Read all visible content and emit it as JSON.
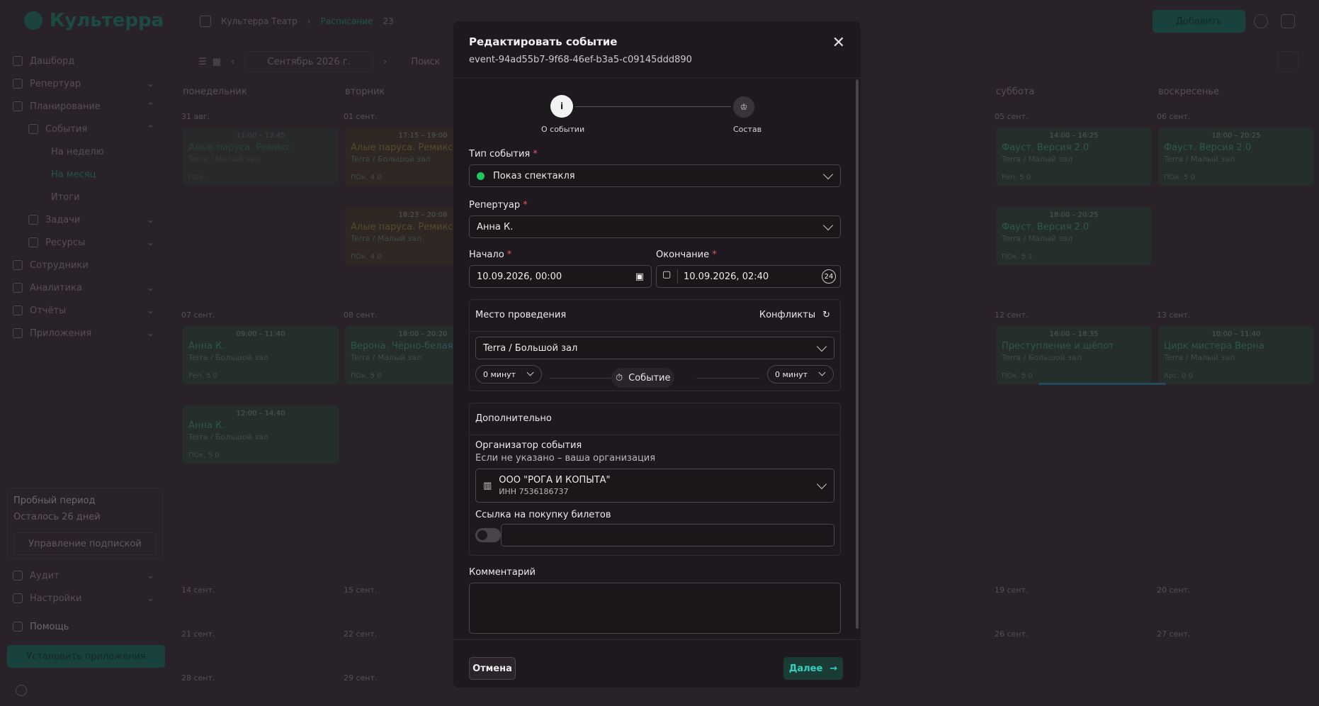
{
  "sidebar": {
    "logo": "Культерра",
    "items": [
      {
        "label": "Дашборд"
      },
      {
        "label": "Репертуар"
      },
      {
        "label": "Планирование"
      },
      {
        "label": "События"
      },
      {
        "label": "На неделю"
      },
      {
        "label": "На месяц"
      },
      {
        "label": "Итоги"
      },
      {
        "label": "Задачи"
      },
      {
        "label": "Ресурсы"
      },
      {
        "label": "Сотрудники"
      },
      {
        "label": "Аналитика"
      },
      {
        "label": "Отчёты"
      },
      {
        "label": "Приложения"
      },
      {
        "label": "Аудит"
      },
      {
        "label": "Настройки"
      },
      {
        "label": "Помощь"
      }
    ],
    "trial": {
      "title": "Пробный период",
      "remaining": "Осталось 26 дней",
      "button": "Управление подпиской"
    },
    "install": "Установить приложения"
  },
  "topbar": {
    "crumb1": "Культерра Театр",
    "crumb2": "Расписание",
    "count": "23",
    "add": "Добавить",
    "month": "Сентябрь 2026 г.",
    "search": "Поиск"
  },
  "calendar": {
    "days": [
      "понедельник",
      "вторник",
      "суббота",
      "воскресенье"
    ],
    "dates": [
      "31 авг.",
      "01 сент.",
      "05 сент.",
      "06 сент.",
      "07 сент.",
      "08 сент.",
      "12 сент.",
      "13 сент.",
      "14 сент.",
      "15 сент.",
      "19 сент.",
      "20 сент.",
      "21 сент.",
      "22 сент.",
      "26 сент.",
      "27 сент.",
      "28 сент.",
      "29 сент."
    ],
    "events": [
      {
        "time": "11:00 – 13:45",
        "title": "Алые паруса. Ремикс",
        "place": "Terra / Малый зал",
        "meta": "ПОк."
      },
      {
        "time": "17:15 – 19:00",
        "title": "Алые паруса. Ремикс",
        "place": "Terra / Большой зал",
        "meta": "ПОк.  4  0"
      },
      {
        "time": "18:23 – 20:08",
        "title": "Алые паруса. Ремикс",
        "place": "Terra / Малый зал",
        "meta": "ПОк.  4  0"
      },
      {
        "time": "14:00 – 16:25",
        "title": "Фауст. Версия 2.0",
        "place": "Terra / Малый зал",
        "meta": "Реп.  5  0"
      },
      {
        "time": "18:00 – 20:25",
        "title": "Фауст. Версия 2.0",
        "place": "Terra / Малый зал",
        "meta": "ПОк.  5  0"
      },
      {
        "time": "18:00 – 20:25",
        "title": "Фауст. Версия 2.0",
        "place": "Terra / Малый зал",
        "meta": "ПОк.  5  1"
      },
      {
        "time": "09:00 – 11:40",
        "title": "Анна К.",
        "place": "Terra / Большой зал",
        "meta": "Реп.  5  0"
      },
      {
        "time": "12:00 – 14:40",
        "title": "Анна К.",
        "place": "Terra / Большой зал",
        "meta": "ПОк.  5  0"
      },
      {
        "time": "18:00 – 20:20",
        "title": "Верона. Чёрно-белая ис...",
        "place": "Terra / Малый зал",
        "meta": "ПОк.  5  0"
      },
      {
        "time": "16:00 – 18:35",
        "title": "Преступление и шёпот",
        "place": "Terra / Большой зал",
        "meta": "ПОк.  5  0"
      },
      {
        "time": "10:00 – 11:40",
        "title": "Цирк мистера Верна",
        "place": "Terra / Малый зал",
        "meta": "Арс.  0  0"
      }
    ]
  },
  "modal": {
    "title": "Редактировать событие",
    "id": "event-94ad55b7-9f68-46ef-b3a5-c09145ddd890",
    "step1": "О событии",
    "step2": "Состав",
    "type_label": "Тип события",
    "type_value": "Показ спектакля",
    "rep_label": "Репертуар",
    "rep_value": "Анна К.",
    "start_label": "Начало",
    "start_value": "10.09.2026, 00:00",
    "end_label": "Окончание",
    "end_value": "10.09.2026, 02:40",
    "venue_label": "Место проведения",
    "conflicts": "Конфликты",
    "venue_value": "Terra / Большой зал",
    "before": "0 минут",
    "event_pill": "Событие",
    "after": "0 минут",
    "extra_label": "Дополнительно",
    "org_label": "Организатор события",
    "org_hint": "Если не указано – ваша организация",
    "org_name": "ООО \"РОГА И КОПЫТА\"",
    "org_inn": "ИНН 7536186737",
    "ticket_label": "Ссылка на покупку билетов",
    "comment_label": "Комментарий",
    "cancel": "Отмена",
    "next": "Далее"
  }
}
